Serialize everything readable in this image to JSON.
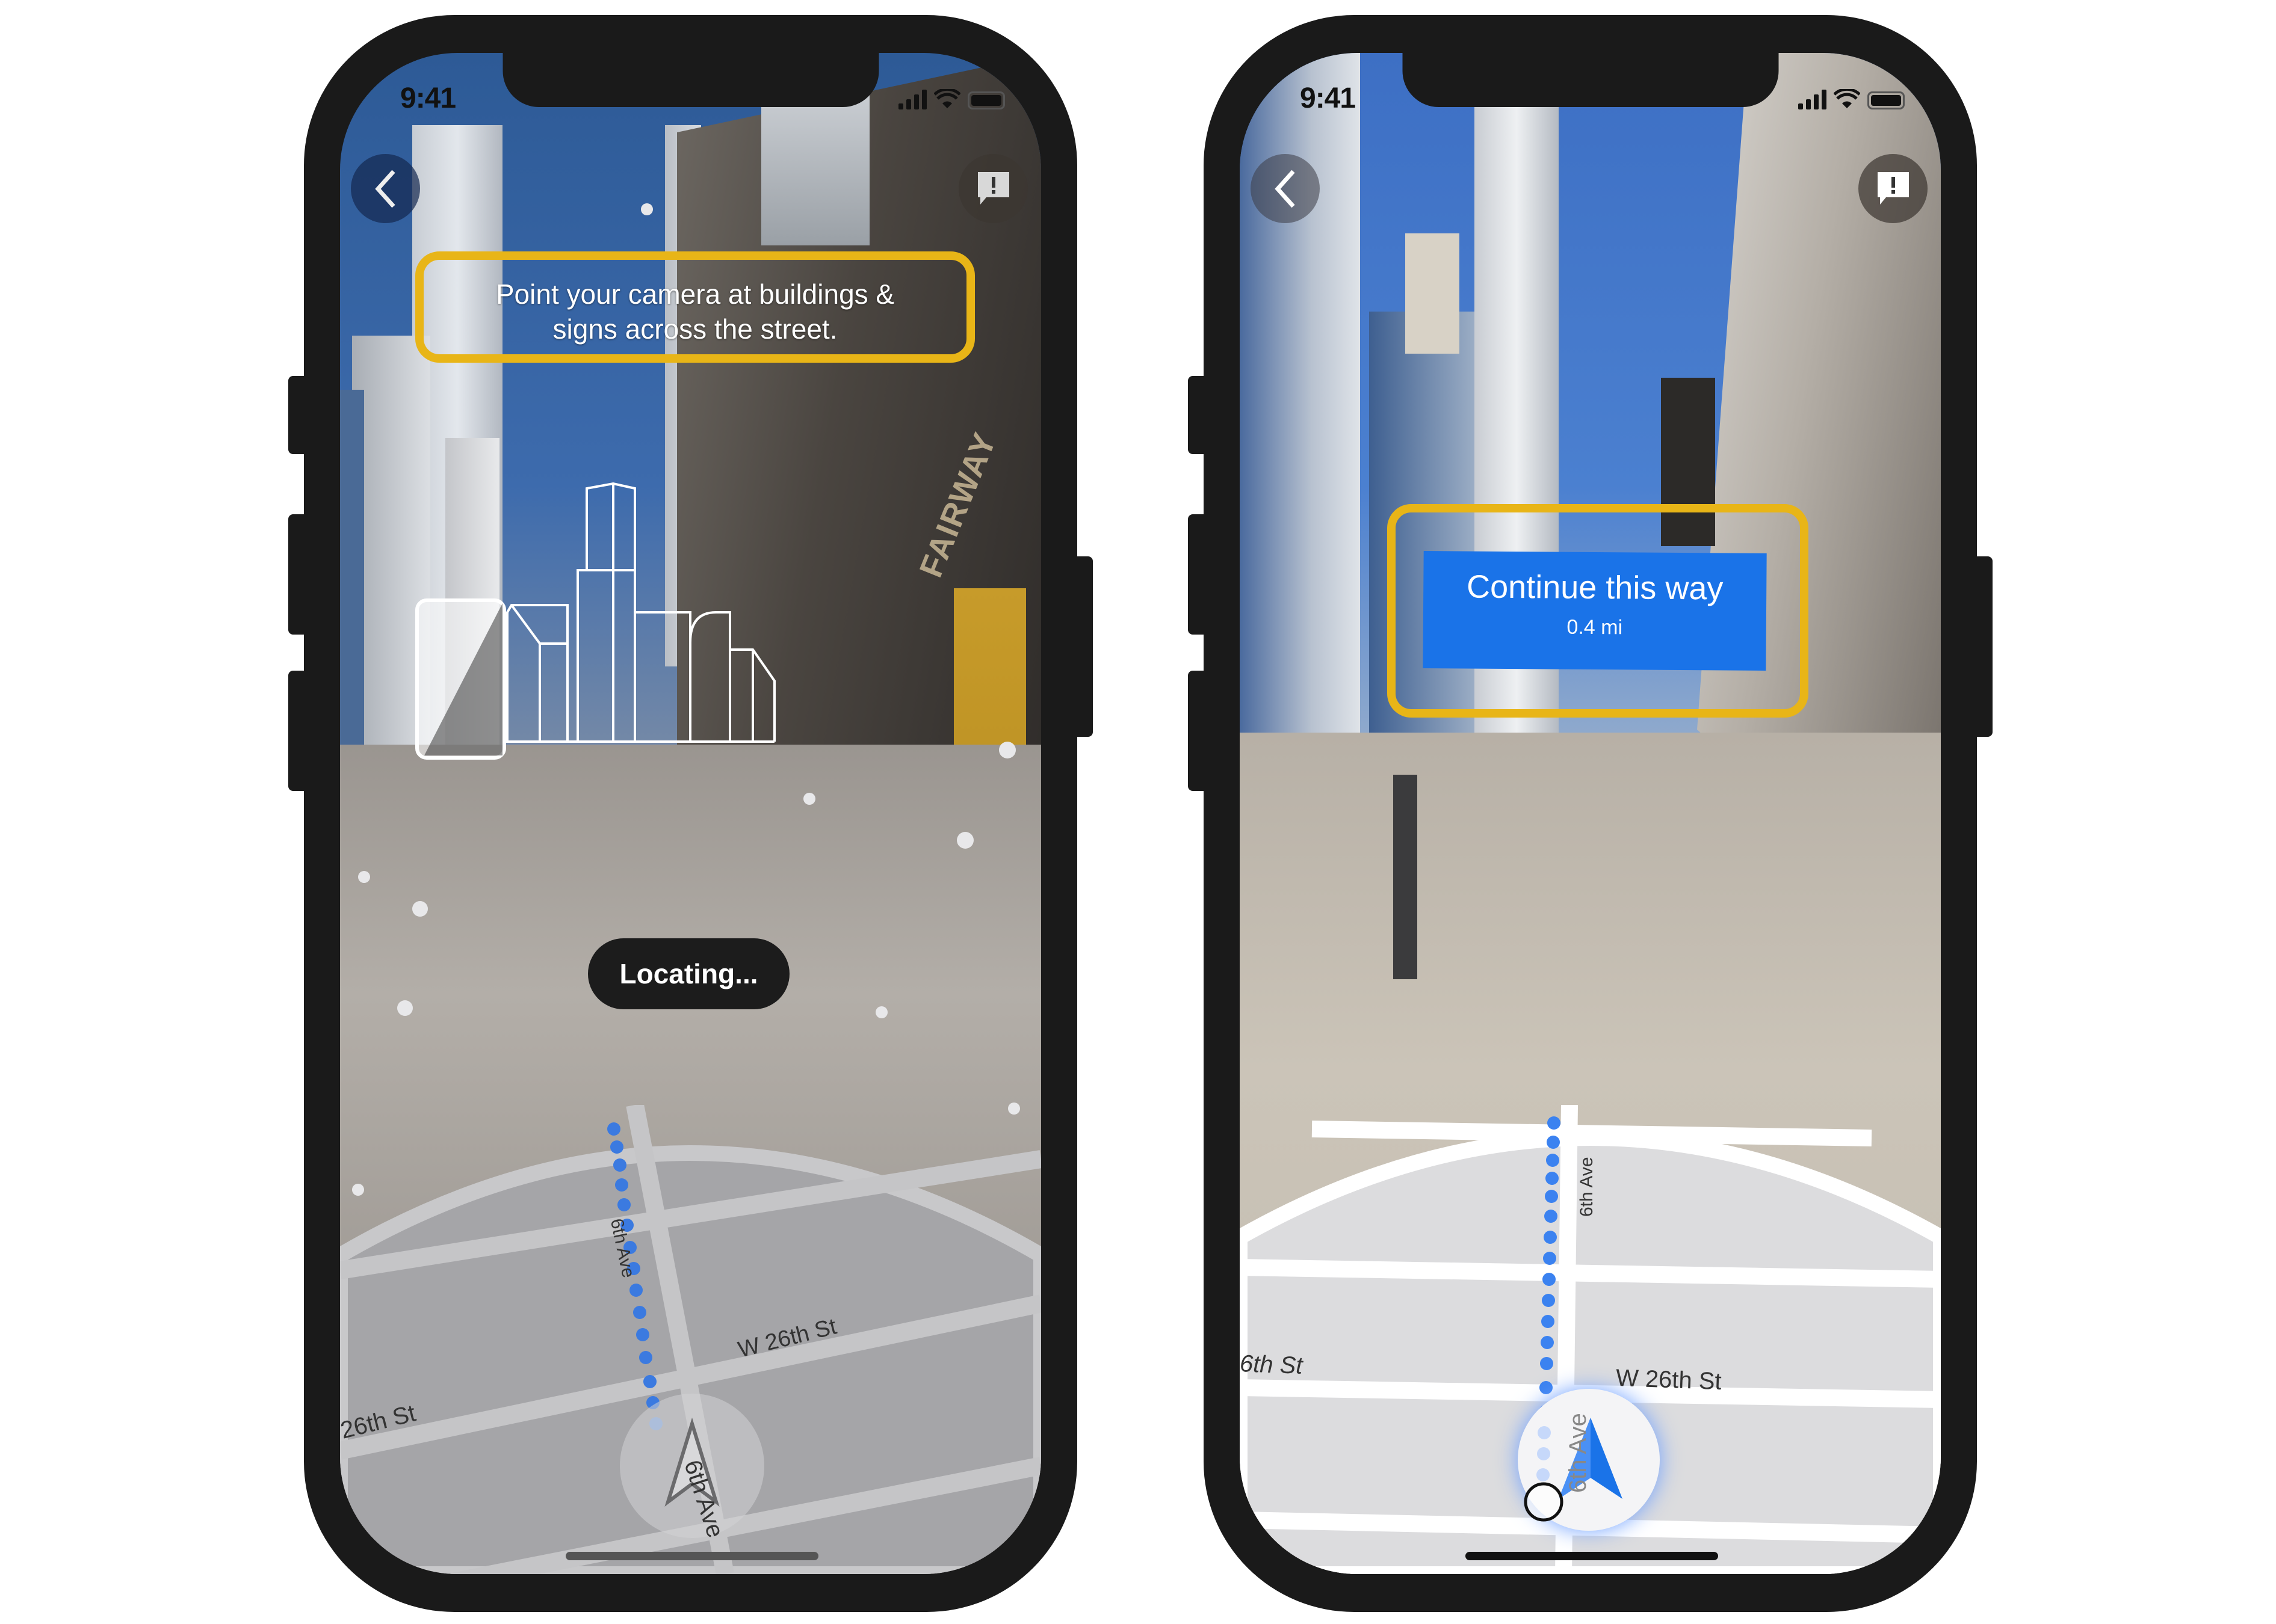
{
  "phones": [
    {
      "id": "left",
      "status_bar": {
        "time": "9:41",
        "signal_icon": "cellular-signal-icon",
        "wifi_icon": "wifi-icon",
        "battery_icon": "battery-icon"
      },
      "back_button": {
        "icon": "chevron-left-icon"
      },
      "report_button": {
        "icon": "feedback-exclamation-icon"
      },
      "hint": {
        "line1": "Point your camera at buildings &",
        "line2": "signs across the street."
      },
      "status_pill": "Locating...",
      "storefront_sign": "FAIRWAY",
      "map": {
        "avenue_label_top": "6th Ave",
        "avenue_label_bottom": "6th Ave",
        "street_label_right": "W 26th St",
        "street_label_left": "26th St",
        "position_marker": "navigation-arrow-outline-icon",
        "state": "inactive"
      }
    },
    {
      "id": "right",
      "status_bar": {
        "time": "9:41",
        "signal_icon": "cellular-signal-icon",
        "wifi_icon": "wifi-icon",
        "battery_icon": "battery-icon"
      },
      "back_button": {
        "icon": "chevron-left-icon"
      },
      "report_button": {
        "icon": "feedback-exclamation-icon"
      },
      "direction_card": {
        "title": "Continue this way",
        "distance": "0.4 mi"
      },
      "map": {
        "avenue_label_top": "6th Ave",
        "avenue_label_bottom": "6th Ave",
        "street_label_right": "W 26th St",
        "street_label_left": "6th St",
        "position_marker": "navigation-arrow-blue-icon",
        "state": "active"
      }
    }
  ],
  "colors": {
    "highlight": "#e8b517",
    "route_blue": "#1a73e8",
    "bezel": "#1a1a1a",
    "pill_bg": "#1c1c1c"
  }
}
